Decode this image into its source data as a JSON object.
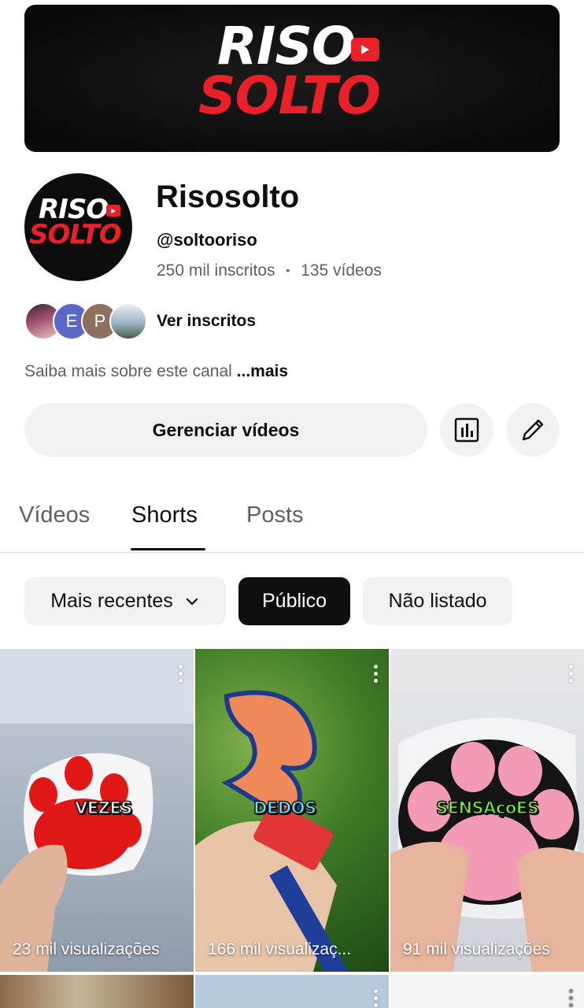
{
  "banner": {
    "logo_top": "RISO",
    "logo_bottom": "SOLTO"
  },
  "avatar": {
    "logo_top": "RISO",
    "logo_bottom": "SOLTO"
  },
  "channel": {
    "name": "Risosolto",
    "handle": "@soltooriso",
    "subscribers": "250 mil inscritos",
    "separator": "•",
    "videos": "135 vídeos"
  },
  "subscribers_preview": {
    "faces": [
      "",
      "E",
      "P",
      ""
    ],
    "link_label": "Ver inscritos"
  },
  "about": {
    "text": "Saiba mais sobre este canal",
    "more": "...mais"
  },
  "actions": {
    "manage_label": "Gerenciar vídeos",
    "analytics_icon": "analytics-icon",
    "edit_icon": "pencil-icon"
  },
  "tabs": [
    {
      "label": "Vídeos",
      "active": false
    },
    {
      "label": "Shorts",
      "active": true
    },
    {
      "label": "Posts",
      "active": false
    }
  ],
  "filters": {
    "sort_label": "Mais recentes",
    "chips": [
      {
        "label": "Público",
        "selected": true
      },
      {
        "label": "Não listado",
        "selected": false
      }
    ]
  },
  "shorts": [
    {
      "caption": "VEZES",
      "views": "23 mil visualizações"
    },
    {
      "caption": "DEDOS",
      "views": "166 mil visualizaç..."
    },
    {
      "caption": "SENSAçõES",
      "views": "91 mil visualizações"
    }
  ],
  "colors": {
    "brand_red": "#e8202a",
    "chip_bg": "#f2f2f2",
    "selected_chip": "#0f0f0f",
    "secondary_text": "#606060"
  }
}
